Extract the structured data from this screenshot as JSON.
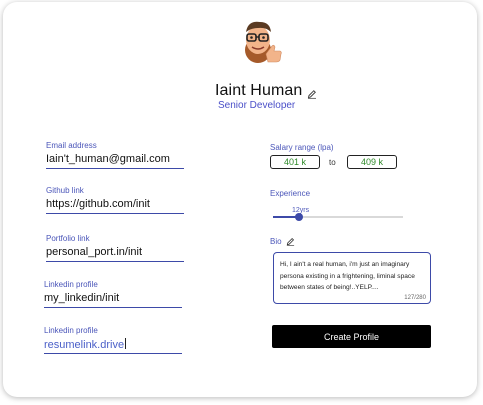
{
  "profile": {
    "name": "Iaint Human",
    "role": "Senior Developer",
    "avatar_icon": "memoji-avatar-thumbs-up",
    "edit_icon": "pencil-icon"
  },
  "fields": [
    {
      "label": "Email address",
      "value": "Iain't_human@gmail.com"
    },
    {
      "label": "Github link",
      "value": "https://github.com/init"
    },
    {
      "label": "Portfolio link",
      "value": "personal_port.in/init"
    },
    {
      "label": "Linkedin profile",
      "value": "my_linkedin/init"
    },
    {
      "label": "Linkedin profile",
      "value": "resumelink.drive"
    }
  ],
  "salary": {
    "label": "Salary range (lpa)",
    "min": "401 k",
    "to": "to",
    "max": "409 k"
  },
  "experience": {
    "label": "Experience",
    "value_label": "12yrs",
    "fraction": 0.2
  },
  "bio": {
    "label": "Bio",
    "text": "Hi, I ain't a real human, i'm just an imaginary persona existing in a frightening, liminal space between states of being!..YELP....",
    "count": "127/280"
  },
  "create_button": "Create Profile",
  "colors": {
    "accent": "#3d4aa8",
    "label": "#4b56b9",
    "salary_text": "#2f8a2a",
    "button": "#000000"
  }
}
